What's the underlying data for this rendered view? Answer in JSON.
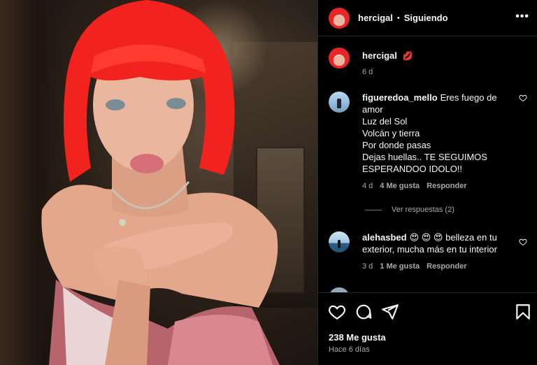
{
  "post": {
    "author": "hercigal",
    "follow_status": "Siguiendo",
    "separator": "•",
    "more_label": "•••"
  },
  "caption": {
    "username": "hercigal",
    "text": "💋",
    "age": "6 d"
  },
  "comments": [
    {
      "username": "figueredoa_mello",
      "lines": [
        "Eres fuego de",
        "amor",
        "Luz del Sol",
        "Volcán y tierra",
        "Por donde pasas",
        "Dejas huellas.. TE SEGUIMOS",
        "ESPERANDOO IDOLO!!"
      ],
      "age": "4 d",
      "likes": "4 Me gusta",
      "reply": "Responder",
      "view_replies": "Ver respuestas (2)"
    },
    {
      "username": "alehasbed",
      "lines": [
        "😍 😍 😍 belleza en tu",
        "exterior, mucha más en tu interior"
      ],
      "age": "3 d",
      "likes": "1 Me gusta",
      "reply": "Responder"
    }
  ],
  "footer": {
    "likes_count": "238 Me gusta",
    "posted": "Hace 6 días"
  },
  "icons": [
    "heart-icon",
    "comment-icon",
    "share-icon",
    "bookmark-icon",
    "more-icon"
  ],
  "colors": {
    "background": "#000000",
    "text": "#f5f5f5",
    "muted": "#a8a8a8",
    "divider": "#262626",
    "hair": "#e8262a"
  }
}
